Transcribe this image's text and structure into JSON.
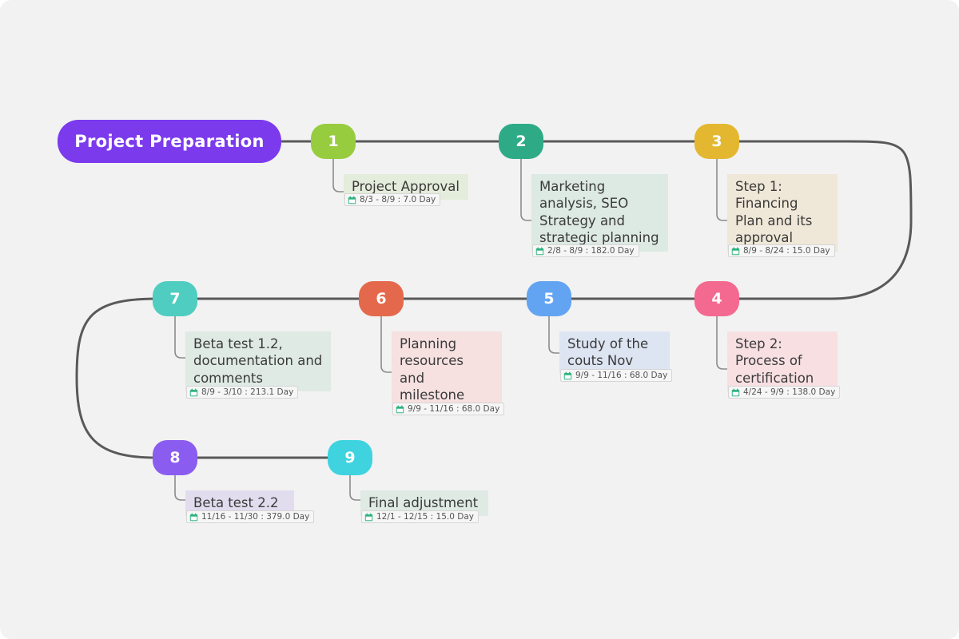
{
  "diagram": {
    "type": "timeline-roadmap",
    "title": "Project Preparation",
    "background_color": "#f2f2f2",
    "connector_color": "#595959",
    "title_pill_color": "#7c3aed",
    "calendar_icon_name": "calendar-icon"
  },
  "nodes": [
    {
      "number": "1",
      "label": "Project Approval",
      "date": "8/3 - 8/9 : 7.0 Day",
      "badge_color": "#97cc3e",
      "label_bg": "#e4ecdb"
    },
    {
      "number": "2",
      "label": "Marketing\nanalysis, SEO\nStrategy and\nstrategic planning",
      "date": "2/8 - 8/9 : 182.0 Day",
      "badge_color": "#2eab86",
      "label_bg": "#dde9e3"
    },
    {
      "number": "3",
      "label": "Step 1:\nFinancing\nPlan and its\napproval",
      "date": "8/9 - 8/24 : 15.0 Day",
      "badge_color": "#e3b730",
      "label_bg": "#efe7d7"
    },
    {
      "number": "4",
      "label": "Step 2:\nProcess of\ncertification",
      "date": "4/24 - 9/9 : 138.0 Day",
      "badge_color": "#f4698f",
      "label_bg": "#f7dfe2"
    },
    {
      "number": "5",
      "label": "Study of the\ncouts Nov",
      "date": "9/9 - 11/16 : 68.0 Day",
      "badge_color": "#63a4f2",
      "label_bg": "#dde4f2"
    },
    {
      "number": "6",
      "label": "Planning\nresources\nand\nmilestone",
      "date": "9/9 - 11/16 : 68.0 Day",
      "badge_color": "#e4694c",
      "label_bg": "#f6e0e0"
    },
    {
      "number": "7",
      "label": "Beta test 1.2,\ndocumentation and\ncomments",
      "date": "8/9 - 3/10 : 213.1 Day",
      "badge_color": "#4ecdc0",
      "label_bg": "#dfeae4"
    },
    {
      "number": "8",
      "label": "Beta test 2.2",
      "date": "11/16 - 11/30 : 379.0 Day",
      "badge_color": "#8b5cf0",
      "label_bg": "#e2ddee"
    },
    {
      "number": "9",
      "label": "Final adjustment",
      "date": "12/1 - 12/15 : 15.0 Day",
      "badge_color": "#3fd3e0",
      "label_bg": "#dfeae4"
    }
  ]
}
